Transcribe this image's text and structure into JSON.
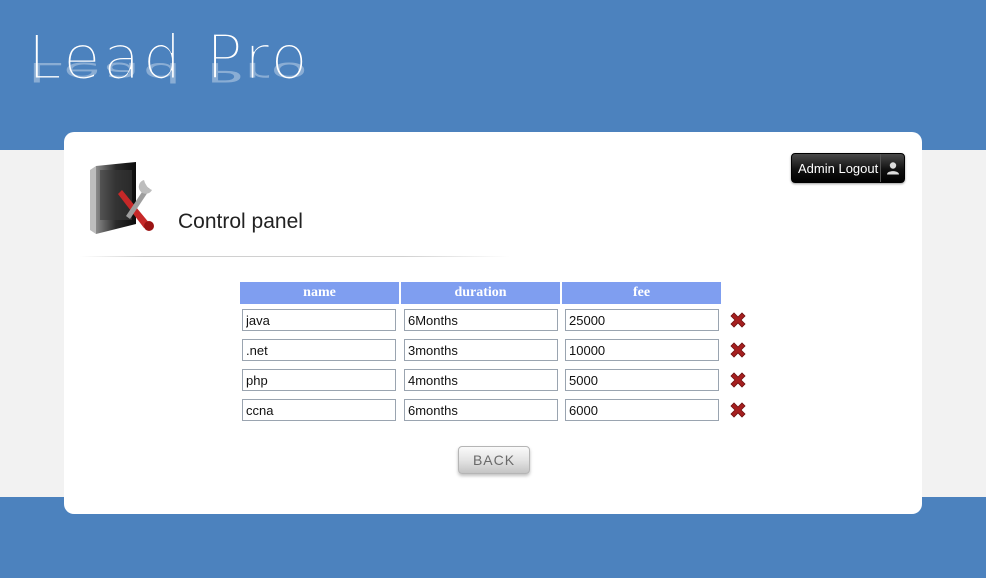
{
  "brand": {
    "logo_text": "Lead Pro"
  },
  "header": {
    "title": "Control panel",
    "logout_label": "Admin Logout",
    "logout_icon": "user-icon"
  },
  "table": {
    "columns": [
      "name",
      "duration",
      "fee"
    ],
    "rows": [
      {
        "name": "java",
        "duration": "6Months",
        "fee": "25000"
      },
      {
        "name": ".net",
        "duration": "3months",
        "fee": "10000"
      },
      {
        "name": "php",
        "duration": "4months",
        "fee": "5000"
      },
      {
        "name": "ccna",
        "duration": "6months",
        "fee": "6000"
      }
    ],
    "delete_icon": "delete-x-icon"
  },
  "footer": {
    "back_label": "BACK"
  },
  "colors": {
    "brand_blue": "#4c82be",
    "header_blue": "#7f9ef0",
    "delete_red": "#a51f1f",
    "page_bg": "#f2f2f2"
  }
}
